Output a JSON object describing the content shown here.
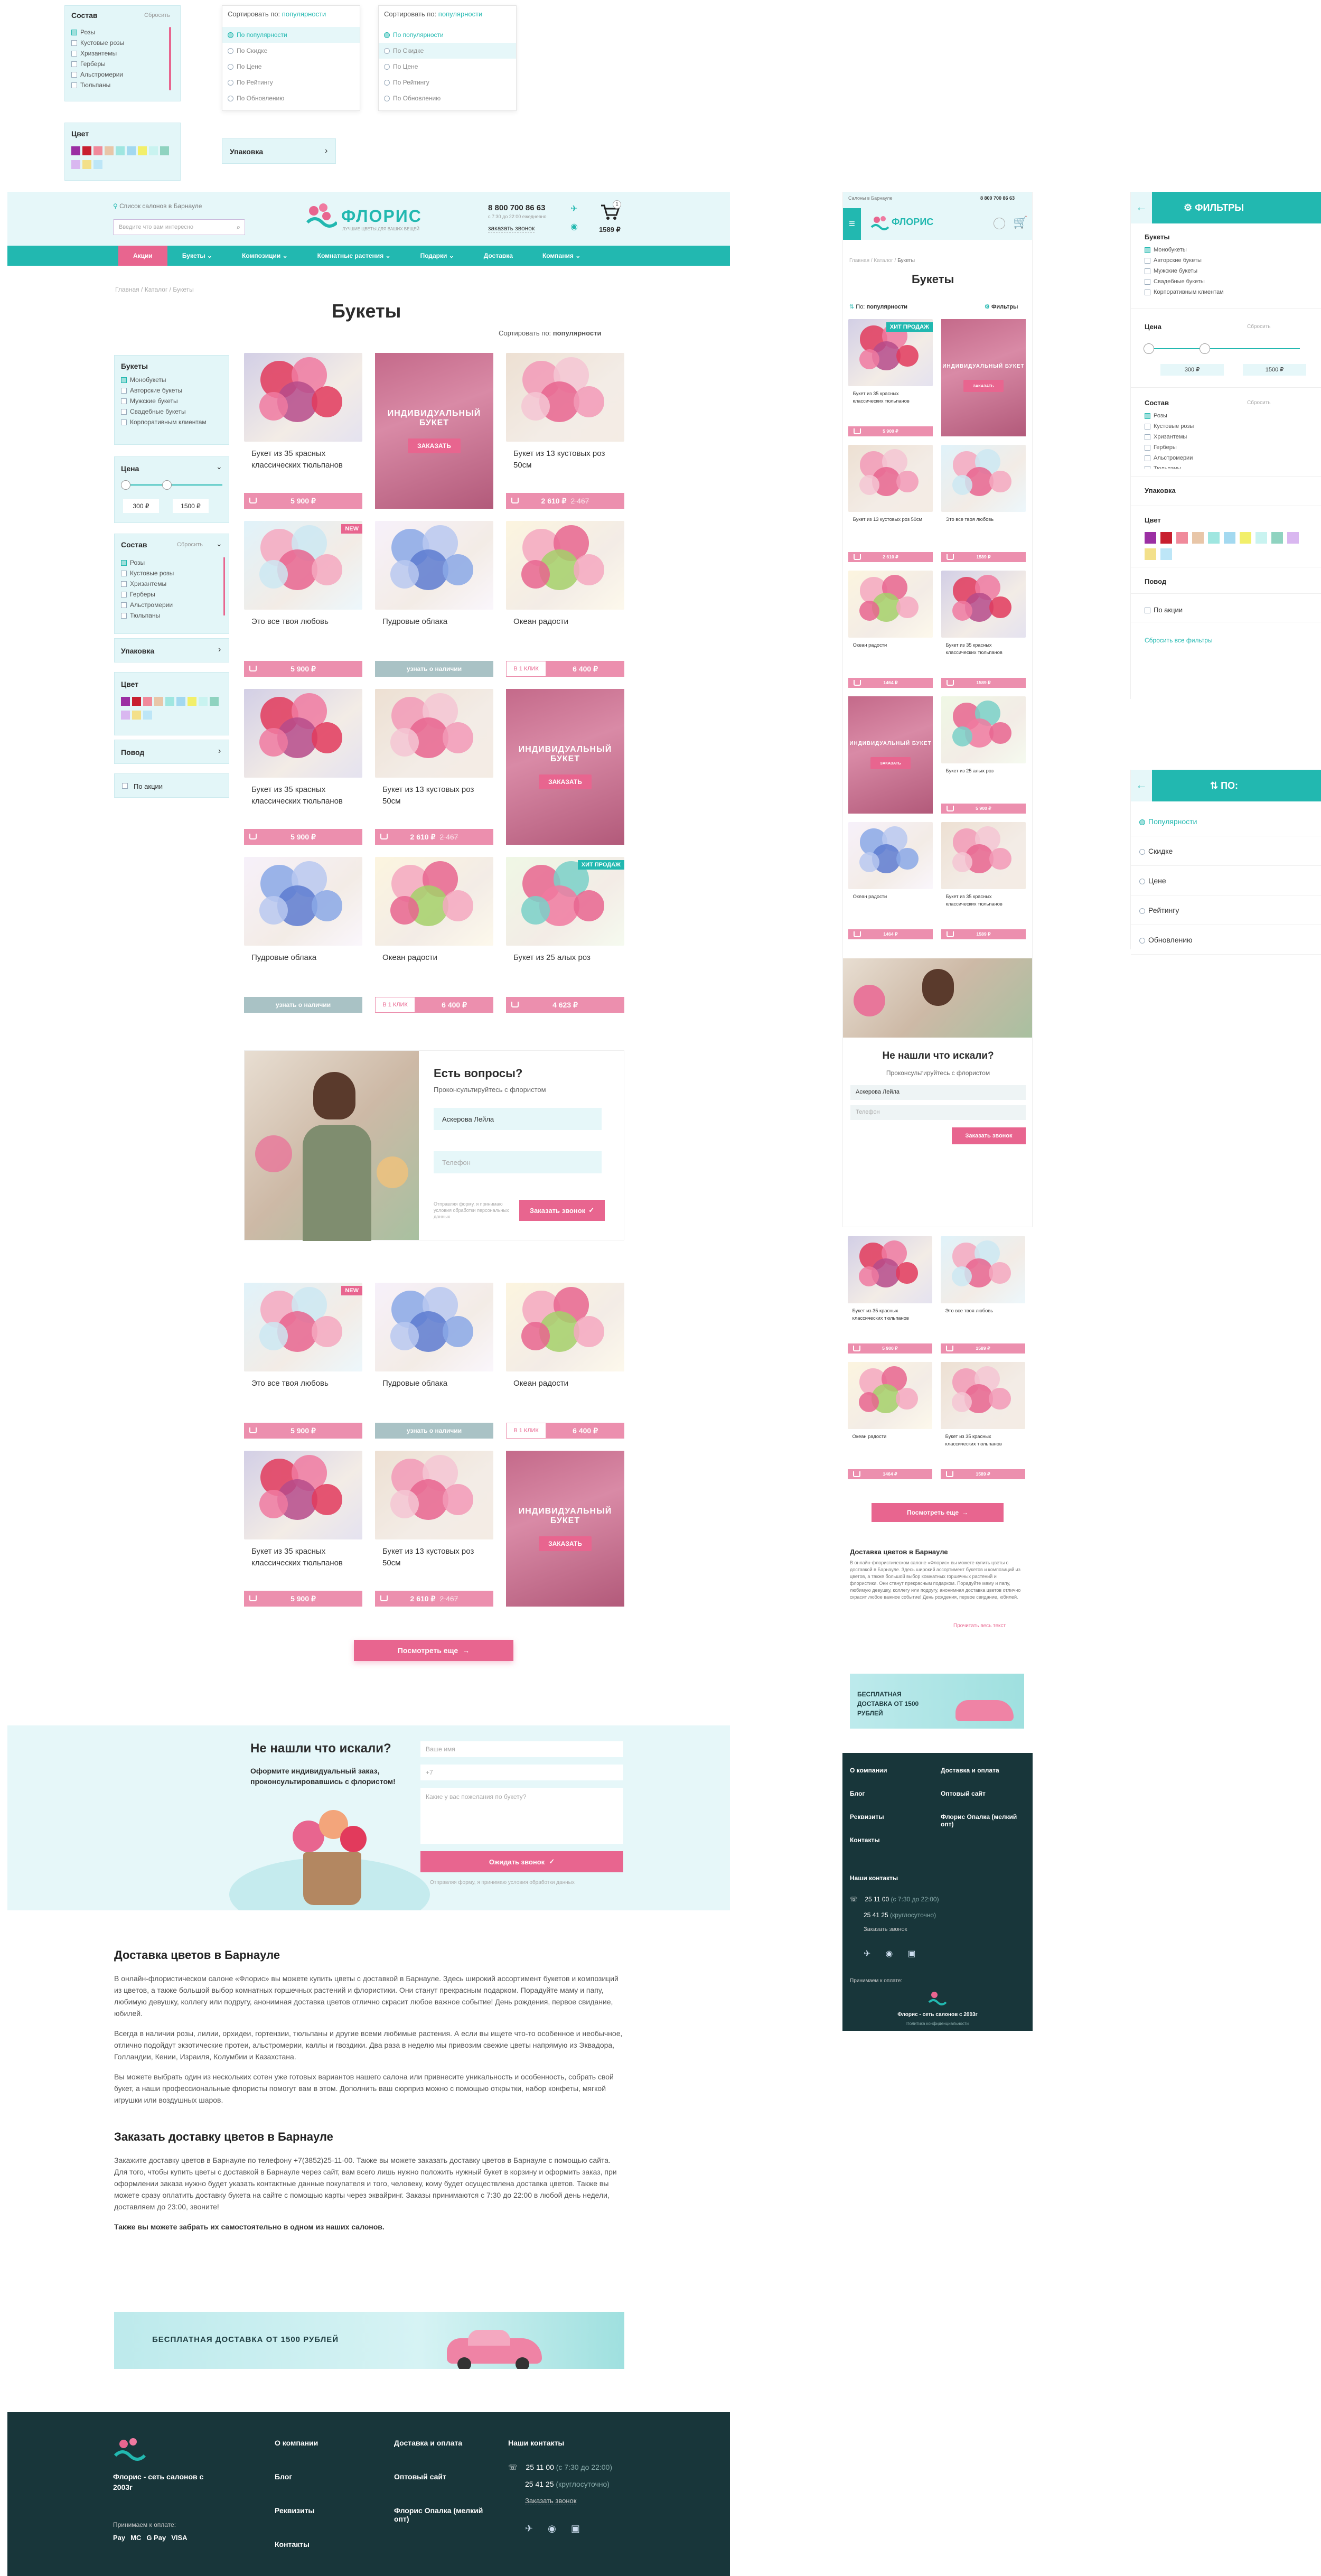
{
  "top_widgets": {
    "sostav_label": "Состав",
    "reset": "Сбросить",
    "sostav_items": [
      "Розы",
      "Кустовые розы",
      "Хризантемы",
      "Герберы",
      "Альстромерии",
      "Тюльпаны"
    ],
    "sort_label": "Сортировать по:",
    "sort_value": "популярности",
    "sort_options": [
      "По популярности",
      "По Скидке",
      "По Цене",
      "По Рейтингу",
      "По Обновлению"
    ],
    "color_label": "Цвет",
    "pack_label": "Упаковка"
  },
  "header": {
    "locate": "Список салонов в Барнауле",
    "search_placeholder": "Введите что вам интересно",
    "logo": "ФЛОРИС",
    "logo_sub": "ЛУЧШИЕ ЦВЕТЫ ДЛЯ ВАШИХ ВЕЩЕЙ",
    "phone": "8 800 700 86 63",
    "hours": "с 7:30 до 22:00 ежедневно",
    "callback": "заказать звонок",
    "cart_sum": "1589 ₽",
    "cart_count": "1"
  },
  "nav": [
    "Акции",
    "Букеты",
    "Композиции",
    "Комнатные растения",
    "Подарки",
    "Доставка",
    "Компания"
  ],
  "breadcrumb": [
    "Главная",
    "Каталог",
    "Букеты"
  ],
  "page_title": "Букеты",
  "sort": {
    "label": "Сортировать по:",
    "value": "популярности"
  },
  "filters": {
    "bouquets_label": "Букеты",
    "bouquets": [
      "Монобукеты",
      "Авторские букеты",
      "Мужские букеты",
      "Свадебные букеты",
      "Корпоративным клиентам"
    ],
    "price_label": "Цена",
    "price_min": "300 ₽",
    "price_max": "1500 ₽",
    "sostav_label": "Состав",
    "reset": "Сбросить",
    "sostav": [
      "Розы",
      "Кустовые розы",
      "Хризантемы",
      "Герберы",
      "Альстромерии",
      "Тюльпаны"
    ],
    "pack_label": "Упаковка",
    "color_label": "Цвет",
    "povod_label": "Повод",
    "promo_label": "По акции",
    "colors": [
      "#9b2fa3",
      "#c81f2f",
      "#f08a9b",
      "#e8c6a8",
      "#9fe6e0",
      "#a3d9f0",
      "#f2ef6a",
      "#c9f3f0",
      "#8fd3c0",
      "#d9b7f0",
      "#f3e08a",
      "#bde6f7"
    ]
  },
  "products_row": [
    [
      {
        "t": "Букет из 35 красных классических тюльпанов",
        "p": "5 900 ₽",
        "k": "a"
      },
      {
        "promo": true
      },
      {
        "t": "Букет из 13 кустовых роз 50см",
        "p": "2 610 ₽",
        "old": "2 467",
        "k": "b"
      }
    ],
    [
      {
        "t": "Это все твоя любовь",
        "p": "5 900 ₽",
        "k": "c",
        "badge": "NEW"
      },
      {
        "t": "Пудровые облака",
        "gray": "узнать о наличии",
        "k": "d"
      },
      {
        "t": "Океан радости",
        "split": "В 1 КЛИК",
        "p": "6 400 ₽",
        "k": "e"
      }
    ],
    [
      {
        "t": "Букет из 35 красных классических тюльпанов",
        "p": "5 900 ₽",
        "k": "a"
      },
      {
        "t": "Букет из 13 кустовых роз 50см",
        "p": "2 610 ₽",
        "old": "2 467",
        "k": "b"
      },
      {
        "promo": true
      }
    ],
    [
      {
        "t": "Пудровые облака",
        "gray": "узнать о наличии",
        "k": "d"
      },
      {
        "t": "Океан радости",
        "split": "В 1 КЛИК",
        "p": "6 400 ₽",
        "k": "e"
      },
      {
        "t": "Букет из 25 алых роз",
        "p": "4 623 ₽",
        "k": "f",
        "badge": "ХИТ ПРОДАЖ"
      }
    ]
  ],
  "products_bottom": [
    [
      {
        "t": "Это все твоя любовь",
        "p": "5 900 ₽",
        "k": "c",
        "badge": "NEW"
      },
      {
        "t": "Пудровые облака",
        "gray": "узнать о наличии",
        "k": "d"
      },
      {
        "t": "Океан радости",
        "split": "В 1 КЛИК",
        "p": "6 400 ₽",
        "k": "e"
      }
    ],
    [
      {
        "t": "Букет из 35 красных классических тюльпанов",
        "p": "5 900 ₽",
        "k": "a"
      },
      {
        "t": "Букет из 13 кустовых роз 50см",
        "p": "2 610 ₽",
        "old": "2 467",
        "k": "b"
      },
      {
        "promo": true
      }
    ]
  ],
  "promo_card": {
    "title": "ИНДИВИДУАЛЬНЫЙ БУКЕТ",
    "btn": "ЗАКАЗАТЬ"
  },
  "question": {
    "title": "Есть вопросы?",
    "sub": "Проконсультируйтесь с флористом",
    "name": "Аскерова Лейла",
    "phone_placeholder": "Телефон",
    "note": "Отправляя форму, я принимаю условия обработки персональных данных",
    "btn": "Заказать звонок"
  },
  "more_btn": "Посмотреть еще",
  "notfound": {
    "title": "Не нашли что искали?",
    "sub": "Оформите индивидуальный заказ, проконсультировавшись с флористом!",
    "name_ph": "Ваше имя",
    "phone_ph": "+7",
    "wish_ph": "Какие у вас пожелания по букету?",
    "btn": "Ожидать звонок",
    "note": "Отправляя форму, я принимаю условия обработки данных"
  },
  "seo": {
    "h1": "Доставка цветов в Барнауле",
    "p1": "В онлайн-флористическом салоне «Флорис» вы можете купить цветы с доставкой в Барнауле. Здесь широкий ассортимент букетов и композиций из цветов, а также большой выбор комнатных горшечных растений и флористики. Они станут прекрасным подарком. Порадуйте маму и папу, любимую девушку, коллегу или подругу, анонимная доставка цветов отлично скрасит любое важное событие! День рождения, первое свидание, юбилей.",
    "p2": "Всегда в наличии розы, лилии, орхидеи, гортензии, тюльпаны и другие всеми любимые растения. А если вы ищете что-то особенное и необычное, отлично подойдут экзотические протеи, альстромерии, каллы и гвоздики. Два раза в неделю мы привозим свежие цветы напрямую из Эквадора, Голландии, Кении, Израиля, Колумбии и Казахстана.",
    "p3": "Вы можете выбрать один из нескольких сотен уже готовых вариантов нашего салона или привнесите уникальность и особенность, собрать свой букет, а наши профессиональные флористы помогут вам в этом. Дополнить ваш сюрприз можно с помощью открытки, набор конфеты, мягкой игрушки или воздушных шаров.",
    "h2": "Заказать доставку цветов в Барнауле",
    "p4": "Закажите доставку цветов в Барнауле по телефону +7(3852)25-11-00. Также вы можете заказать доставку цветов в Барнауле с помощью сайта. Для того, чтобы купить цветы с доставкой в Барнауле через сайт, вам всего лишь нужно положить нужный букет в корзину и оформить заказ, при оформлении заказа нужно будет указать контактные данные покупателя и того, человеку, кому будет осуществлена доставка цветов. Также вы можете сразу оплатить доставку букета на сайте с помощью карты через эквайринг. Заказы принимаются с 7:30 до 22:00 в любой день недели, доставляем до 23:00, звоните!",
    "p5": "Также вы можете забрать их самостоятельно в одном из наших салонов."
  },
  "banner": "БЕСПЛАТНАЯ ДОСТАВКА ОТ 1500 РУБЛЕЙ",
  "footer": {
    "brand": "Флорис - сеть салонов с 2003г",
    "pay": "Принимаем к оплате:",
    "pay_methods": [
      "Pay",
      "MC",
      "G Pay",
      "VISA"
    ],
    "col1": [
      "О компании",
      "Блог",
      "Реквизиты",
      "Контакты"
    ],
    "col2": [
      "Доставка и оплата",
      "Оптовый сайт",
      "Флорис Опалка (мелкий опт)"
    ],
    "contacts_label": "Наши контакты",
    "phone1": "25 11 00",
    "phone1_note": "(с 7:30 до 22:00)",
    "phone2": "25 41 25",
    "phone2_note": "(круглосуточно)",
    "callback": "Заказать звонок",
    "privacy": "Политика конфиденциальности"
  },
  "mobile": {
    "header_loc": "Салоны в Барнауле",
    "phone": "8 800 700 86 63",
    "title": "Букеты",
    "sort": "По:",
    "sort_value": "популярности",
    "filters": "Фильтры",
    "more_btn": "Посмотреть еще",
    "seo_title": "Доставка цветов в Барнауле",
    "seo_more": "Прочитать весь текст",
    "banner": "БЕСПЛАТНАЯ ДОСТАВКА ОТ 1500 РУБЛЕЙ",
    "products_mini": [
      "Букет из 35 красных классических тюльпанов",
      "Букет из 13 кустовых роз 50см",
      "Это все твоя любовь",
      "Океан радости",
      "Букет из 35 красных классических тюльпанов",
      "Букет из 25 алых роз",
      "Океан радости"
    ],
    "prices_mini": [
      "5 900 ₽",
      "2 610 ₽",
      "1589 ₽",
      "1464 ₽"
    ],
    "notfound_title": "Не нашли что искали?",
    "notfound_sub": "Проконсультируйтесь с флористом",
    "name": "Аскерова Лейла",
    "phone_ph": "Телефон",
    "call_btn": "Заказать звонок"
  },
  "mobile_filters": {
    "title": "ФИЛЬТРЫ",
    "reset_all": "Сбросить все фильтры"
  },
  "mobile_sort": {
    "title": "ПО:",
    "options": [
      "Популярности",
      "Скидке",
      "Цене",
      "Рейтингу",
      "Обновлению"
    ]
  }
}
